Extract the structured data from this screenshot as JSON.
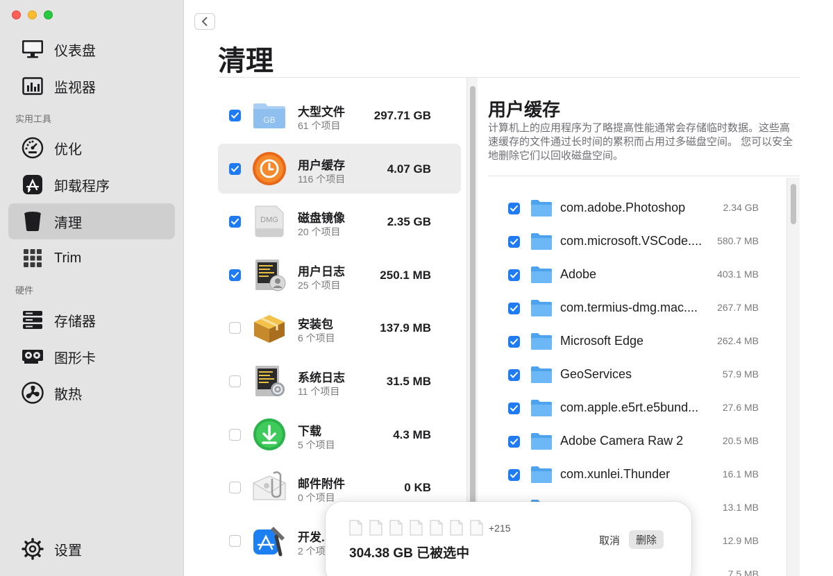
{
  "sidebar": {
    "items": [
      {
        "label": "仪表盘",
        "icon": "display-icon"
      },
      {
        "label": "监视器",
        "icon": "monitor-chart-icon"
      },
      {
        "label": "优化",
        "icon": "speedometer-icon"
      },
      {
        "label": "卸载程序",
        "icon": "app-store-icon"
      },
      {
        "label": "清理",
        "icon": "trash-bin-icon"
      },
      {
        "label": "Trim",
        "icon": "grid-icon"
      },
      {
        "label": "存储器",
        "icon": "storage-icon"
      },
      {
        "label": "图形卡",
        "icon": "graphics-card-icon"
      },
      {
        "label": "散热",
        "icon": "fan-icon"
      }
    ],
    "sections": {
      "tools": "实用工具",
      "hardware": "硬件"
    },
    "settings_label": "设置",
    "active": "清理"
  },
  "header": {
    "title": "清理"
  },
  "categories": [
    {
      "name": "大型文件",
      "count": "61 个项目",
      "size": "297.71 GB",
      "checked": true,
      "icon": "large-files-folder-icon"
    },
    {
      "name": "用户缓存",
      "count": "116 个项目",
      "size": "4.07 GB",
      "checked": true,
      "icon": "user-cache-clock-icon"
    },
    {
      "name": "磁盘镜像",
      "count": "20 个项目",
      "size": "2.35 GB",
      "checked": true,
      "icon": "dmg-icon"
    },
    {
      "name": "用户日志",
      "count": "25 个项目",
      "size": "250.1 MB",
      "checked": true,
      "icon": "user-log-icon"
    },
    {
      "name": "安装包",
      "count": "6 个项目",
      "size": "137.9 MB",
      "checked": false,
      "icon": "package-box-icon"
    },
    {
      "name": "系统日志",
      "count": "11 个项目",
      "size": "31.5 MB",
      "checked": false,
      "icon": "system-log-icon"
    },
    {
      "name": "下载",
      "count": "5 个项目",
      "size": "4.3 MB",
      "checked": false,
      "icon": "download-icon"
    },
    {
      "name": "邮件附件",
      "count": "0 个项目",
      "size": "0 KB",
      "checked": false,
      "icon": "mail-attachment-icon"
    },
    {
      "name": "开发...",
      "count": "2 个项",
      "size": "",
      "checked": false,
      "icon": "xcode-icon"
    }
  ],
  "detail": {
    "title": "用户缓存",
    "description": "计算机上的应用程序为了略提高性能通常会存储临时数据。这些高速缓存的文件通过长时间的累积而占用过多磁盘空间。 您可以安全地删除它们以回收磁盘空间。",
    "files": [
      {
        "name": "com.adobe.Photoshop",
        "size": "2.34 GB",
        "checked": true
      },
      {
        "name": "com.microsoft.VSCode....",
        "size": "580.7 MB",
        "checked": true
      },
      {
        "name": "Adobe",
        "size": "403.1 MB",
        "checked": true
      },
      {
        "name": "com.termius-dmg.mac....",
        "size": "267.7 MB",
        "checked": true
      },
      {
        "name": "Microsoft Edge",
        "size": "262.4 MB",
        "checked": true
      },
      {
        "name": "GeoServices",
        "size": "57.9 MB",
        "checked": true
      },
      {
        "name": "com.apple.e5rt.e5bund...",
        "size": "27.6 MB",
        "checked": true
      },
      {
        "name": "Adobe Camera Raw 2",
        "size": "20.5 MB",
        "checked": true
      },
      {
        "name": "com.xunlei.Thunder",
        "size": "16.1 MB",
        "checked": true
      },
      {
        "name": "",
        "size": "13.1 MB",
        "checked": true
      },
      {
        "name": "",
        "size": "12.9 MB",
        "checked": true
      },
      {
        "name": "",
        "size": "7.5 MB",
        "checked": true
      }
    ]
  },
  "selection_panel": {
    "more_count": "+215",
    "selected_text": "304.38 GB 已被选中",
    "cancel_label": "取消",
    "delete_label": "删除"
  },
  "colors": {
    "accent": "#1f7bf2",
    "sidebar_bg": "#e4e4e4",
    "folder": "#5aaef5"
  }
}
